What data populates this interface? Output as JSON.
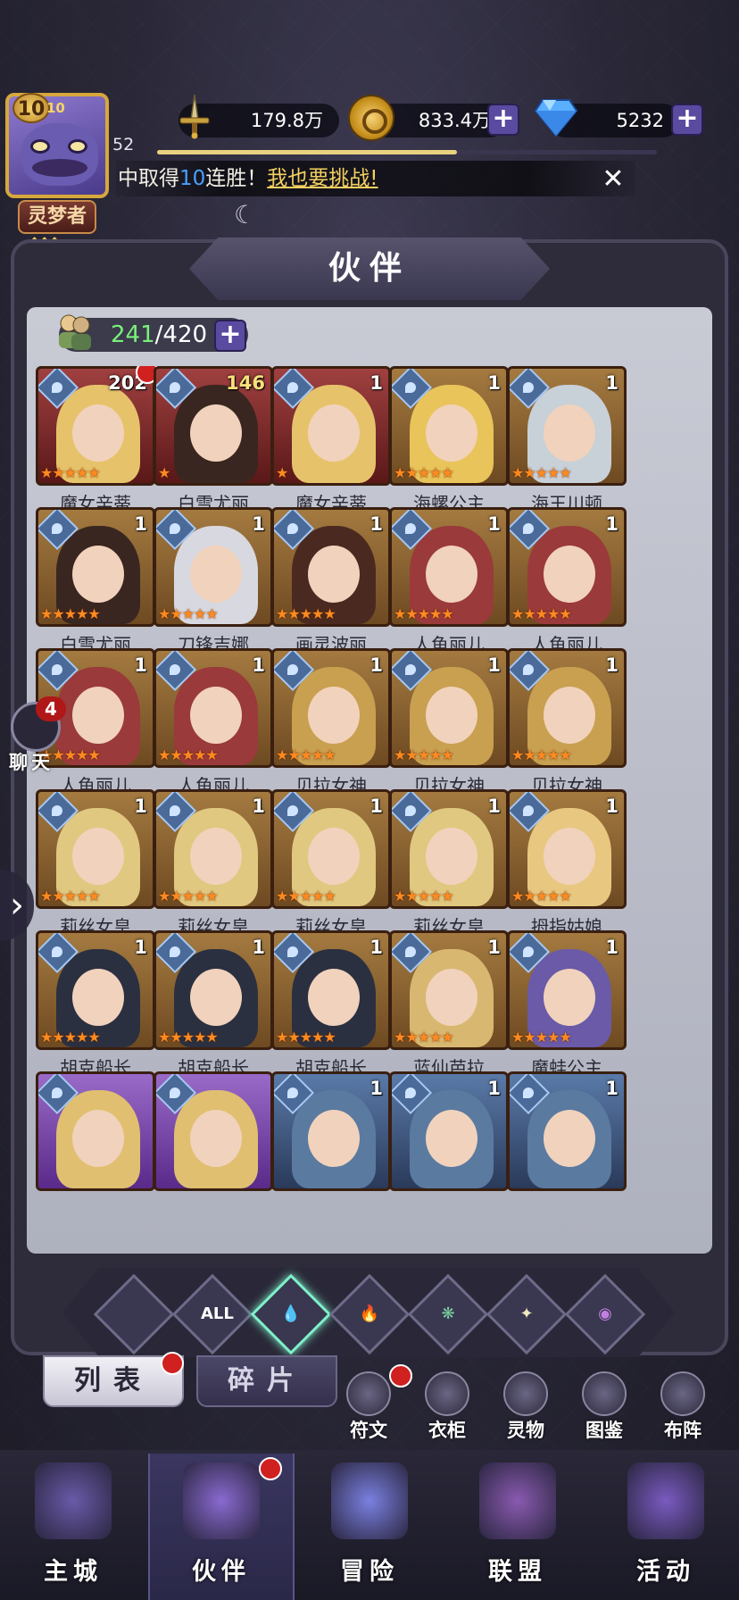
{
  "player": {
    "vip_level": "10",
    "vip_sub": "10",
    "rank_title": "灵梦者",
    "level": "52",
    "xp_fraction": 0.6
  },
  "resources": {
    "power": "179.8万",
    "gold": "833.4万",
    "diamond": "5232"
  },
  "ticker": {
    "prefix": "中取得",
    "streak": "10",
    "suffix": "连胜！",
    "link": "我也要挑战!"
  },
  "panel": {
    "title": "伙伴",
    "count_current": "241",
    "count_sep": "/420"
  },
  "cards": [
    {
      "name": "魔女辛蒂",
      "num": "202",
      "stars": "★★★★★",
      "color": "red",
      "hair": "#e6c36a",
      "dot": true,
      "numgold": false
    },
    {
      "name": "白雪尤丽",
      "num": "146",
      "stars": "★",
      "color": "red",
      "hair": "#3a2620",
      "dot": false,
      "numgold": true
    },
    {
      "name": "魔女辛蒂",
      "num": "1",
      "stars": "★",
      "color": "red",
      "hair": "#e6c36a",
      "dot": false,
      "numgold": false
    },
    {
      "name": "海螺公主",
      "num": "1",
      "stars": "★★★★★",
      "color": "gold",
      "hair": "#e8c45a",
      "dot": false,
      "numgold": false
    },
    {
      "name": "海王川顿",
      "num": "1",
      "stars": "★★★★★",
      "color": "gold",
      "hair": "#c8d0d8",
      "dot": false,
      "numgold": false
    },
    {
      "name": "白雪尤丽",
      "num": "1",
      "stars": "★★★★★",
      "color": "gold",
      "hair": "#3a2620",
      "dot": false,
      "numgold": false
    },
    {
      "name": "刀锋吉娜",
      "num": "1",
      "stars": "★★★★★",
      "color": "gold",
      "hair": "#d8d8e0",
      "dot": false,
      "numgold": false
    },
    {
      "name": "画灵波丽",
      "num": "1",
      "stars": "★★★★★",
      "color": "gold",
      "hair": "#4a2a20",
      "dot": false,
      "numgold": false
    },
    {
      "name": "人鱼丽儿",
      "num": "1",
      "stars": "★★★★★",
      "color": "gold",
      "hair": "#9a3a3a",
      "dot": false,
      "numgold": false
    },
    {
      "name": "人鱼丽儿",
      "num": "1",
      "stars": "★★★★★",
      "color": "gold",
      "hair": "#9a3a3a",
      "dot": false,
      "numgold": false
    },
    {
      "name": "人鱼丽儿",
      "num": "1",
      "stars": "★★★★★",
      "color": "gold",
      "hair": "#9a3a3a",
      "dot": false,
      "numgold": false
    },
    {
      "name": "人鱼丽儿",
      "num": "1",
      "stars": "★★★★★",
      "color": "gold",
      "hair": "#9a3a3a",
      "dot": false,
      "numgold": false
    },
    {
      "name": "贝拉女神",
      "num": "1",
      "stars": "★★★★★",
      "color": "gold",
      "hair": "#c8a050",
      "dot": false,
      "numgold": false
    },
    {
      "name": "贝拉女神",
      "num": "1",
      "stars": "★★★★★",
      "color": "gold",
      "hair": "#c8a050",
      "dot": false,
      "numgold": false
    },
    {
      "name": "贝拉女神",
      "num": "1",
      "stars": "★★★★★",
      "color": "gold",
      "hair": "#c8a050",
      "dot": false,
      "numgold": false
    },
    {
      "name": "莉丝女皇",
      "num": "1",
      "stars": "★★★★★",
      "color": "gold",
      "hair": "#e0c880",
      "dot": false,
      "numgold": false
    },
    {
      "name": "莉丝女皇",
      "num": "1",
      "stars": "★★★★★",
      "color": "gold",
      "hair": "#e0c880",
      "dot": false,
      "numgold": false
    },
    {
      "name": "莉丝女皇",
      "num": "1",
      "stars": "★★★★★",
      "color": "gold",
      "hair": "#e0c880",
      "dot": false,
      "numgold": false
    },
    {
      "name": "莉丝女皇",
      "num": "1",
      "stars": "★★★★★",
      "color": "gold",
      "hair": "#e0c880",
      "dot": false,
      "numgold": false
    },
    {
      "name": "拇指姑娘",
      "num": "1",
      "stars": "★★★★★",
      "color": "gold",
      "hair": "#e8c880",
      "dot": false,
      "numgold": false
    },
    {
      "name": "胡克船长",
      "num": "1",
      "stars": "★★★★★",
      "color": "gold",
      "hair": "#2a3040",
      "dot": false,
      "numgold": false
    },
    {
      "name": "胡克船长",
      "num": "1",
      "stars": "★★★★★",
      "color": "gold",
      "hair": "#2a3040",
      "dot": false,
      "numgold": false
    },
    {
      "name": "胡克船长",
      "num": "1",
      "stars": "★★★★★",
      "color": "gold",
      "hair": "#2a3040",
      "dot": false,
      "numgold": false
    },
    {
      "name": "蓝仙芭拉",
      "num": "1",
      "stars": "★★★★★",
      "color": "gold",
      "hair": "#d8b870",
      "dot": false,
      "numgold": false
    },
    {
      "name": "魔蛙公主",
      "num": "1",
      "stars": "★★★★★",
      "color": "gold",
      "hair": "#6a5aa8",
      "dot": false,
      "numgold": false
    },
    {
      "name": "",
      "num": "",
      "stars": "",
      "color": "purple",
      "hair": "#e0c070",
      "dot": false,
      "numgold": false
    },
    {
      "name": "",
      "num": "",
      "stars": "",
      "color": "purple",
      "hair": "#e0c070",
      "dot": false,
      "numgold": false
    },
    {
      "name": "",
      "num": "1",
      "stars": "",
      "color": "blue",
      "hair": "#5a7aa0",
      "dot": false,
      "numgold": false
    },
    {
      "name": "",
      "num": "1",
      "stars": "",
      "color": "blue",
      "hair": "#5a7aa0",
      "dot": false,
      "numgold": false
    },
    {
      "name": "",
      "num": "1",
      "stars": "",
      "color": "blue",
      "hair": "#5a7aa0",
      "dot": false,
      "numgold": false
    }
  ],
  "filters": [
    {
      "glyph": "",
      "color": "#7ab0e8",
      "sel": false
    },
    {
      "glyph": "ALL",
      "color": "#ffffff",
      "sel": false
    },
    {
      "glyph": "💧",
      "color": "#7ab0e8",
      "sel": true
    },
    {
      "glyph": "🔥",
      "color": "#ff6a40",
      "sel": false
    },
    {
      "glyph": "❋",
      "color": "#7ad0a0",
      "sel": false
    },
    {
      "glyph": "✦",
      "color": "#f0e8c0",
      "sel": false
    },
    {
      "glyph": "◉",
      "color": "#c080e0",
      "sel": false
    }
  ],
  "tabs": {
    "list": "列表",
    "fragments": "碎片"
  },
  "side_buttons": [
    "符文",
    "衣柜",
    "灵物",
    "图鉴",
    "布阵"
  ],
  "chat": {
    "label": "聊天",
    "badge": "4"
  },
  "nav": [
    {
      "label": "主城",
      "color": "#6a5aa8"
    },
    {
      "label": "伙伴",
      "color": "#8a6ad0"
    },
    {
      "label": "冒险",
      "color": "#7a80e0"
    },
    {
      "label": "联盟",
      "color": "#8a5ab0"
    },
    {
      "label": "活动",
      "color": "#7a5ac0"
    }
  ]
}
